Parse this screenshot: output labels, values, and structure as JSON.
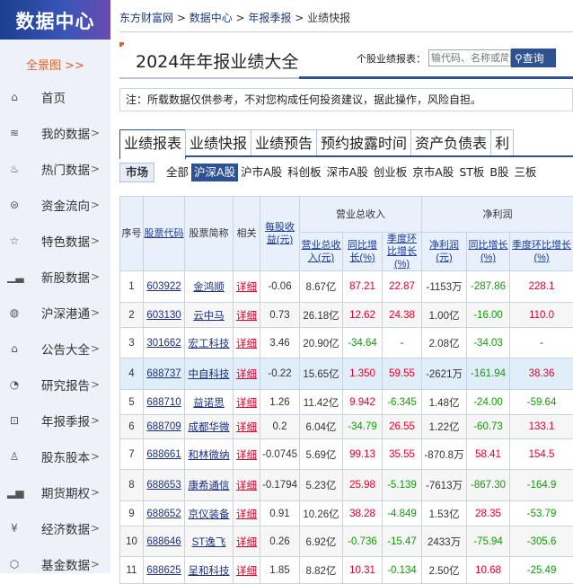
{
  "sidebar": {
    "logo": "数据中心",
    "overview": "全景图 >>",
    "items": [
      {
        "label": "首页",
        "icon": "home-icon",
        "glyph": "⌂",
        "chevron": ""
      },
      {
        "label": "我的数据",
        "icon": "layers-icon",
        "glyph": "≋",
        "chevron": ">"
      },
      {
        "label": "热门数据",
        "icon": "fire-icon",
        "glyph": "♨",
        "chevron": ">"
      },
      {
        "label": "资金流向",
        "icon": "flow-icon",
        "glyph": "⊜",
        "chevron": ">"
      },
      {
        "label": "特色数据",
        "icon": "star-badge-icon",
        "glyph": "☆",
        "chevron": ">"
      },
      {
        "label": "新股数据",
        "icon": "bar-icon",
        "glyph": "▁▃",
        "chevron": ">"
      },
      {
        "label": "沪深港通",
        "icon": "globe-icon",
        "glyph": "◍",
        "chevron": ">"
      },
      {
        "label": "公告大全",
        "icon": "notice-icon",
        "glyph": "⌂",
        "chevron": ">"
      },
      {
        "label": "研究报告",
        "icon": "pie-icon",
        "glyph": "◔",
        "chevron": ">"
      },
      {
        "label": "年报季报",
        "icon": "chart-icon",
        "glyph": "⊡",
        "chevron": ">"
      },
      {
        "label": "股东股本",
        "icon": "user-icon",
        "glyph": "♙",
        "chevron": ">"
      },
      {
        "label": "期货期权",
        "icon": "histogram-icon",
        "glyph": "▂▅",
        "chevron": ">"
      },
      {
        "label": "经济数据",
        "icon": "yen-icon",
        "glyph": "¥",
        "chevron": ">"
      },
      {
        "label": "基金数据",
        "icon": "fund-icon",
        "glyph": "⬡",
        "chevron": ">"
      }
    ]
  },
  "breadcrumb": [
    "东方财富网",
    "数据中心",
    "年报季报",
    "业绩快报"
  ],
  "title": "2024年年报业绩大全",
  "search": {
    "label": "个股业绩报表：",
    "placeholder": "输代码、名称或简拼",
    "button": "查询"
  },
  "note": "注：所载数据仅供参考，不对您构成任何投资建议，据此操作，风险自担。",
  "tabs": [
    "业绩报表",
    "业绩快报",
    "业绩预告",
    "预约披露时间",
    "资产负债表",
    "利"
  ],
  "market": {
    "label": "市场",
    "options": [
      "全部",
      "沪深A股",
      "沪市A股",
      "科创板",
      "深市A股",
      "创业板",
      "京市A股",
      "ST板",
      "B股",
      "三板"
    ],
    "selected": 1
  },
  "table": {
    "headers": {
      "seq": "序号",
      "code": "股票代码",
      "name": "股票简称",
      "rel": "相关",
      "eps": "每股收益(元)",
      "rev_group": "营业总收入",
      "rev": "营业总收入(元)",
      "rev_yoy": "同比增长(%)",
      "rev_qoq": "季度环比增长(%)",
      "np_group": "净利润",
      "np": "净利润(元)",
      "np_yoy": "同比增长(%)",
      "np_qoq": "季度环比增长(%)"
    },
    "rows": [
      [
        "1",
        "603922",
        "金鸿顺",
        "详细",
        "-0.06",
        "8.67亿",
        "87.21",
        "22.87",
        "-1153万",
        "-287.86",
        "228.1"
      ],
      [
        "2",
        "603130",
        "云中马",
        "详细",
        "0.73",
        "26.18亿",
        "12.62",
        "24.38",
        "1.00亿",
        "-16.00",
        "110.0"
      ],
      [
        "3",
        "301662",
        "宏工科技",
        "详细",
        "3.46",
        "20.90亿",
        "-34.64",
        "-",
        "2.08亿",
        "-34.03",
        "-"
      ],
      [
        "4",
        "688737",
        "中自科技",
        "详细",
        "-0.22",
        "15.65亿",
        "1.350",
        "59.55",
        "-2621万",
        "-161.94",
        "38.36"
      ],
      [
        "5",
        "688710",
        "益诺思",
        "详细",
        "1.26",
        "11.42亿",
        "9.942",
        "-6.345",
        "1.48亿",
        "-24.00",
        "-59.64"
      ],
      [
        "6",
        "688709",
        "成都华微",
        "详细",
        "0.2",
        "6.04亿",
        "-34.79",
        "26.55",
        "1.22亿",
        "-60.73",
        "133.1"
      ],
      [
        "7",
        "688661",
        "和林微纳",
        "详细",
        "-0.0745",
        "5.69亿",
        "99.13",
        "35.55",
        "-870.8万",
        "58.41",
        "154.5"
      ],
      [
        "8",
        "688653",
        "康希通信",
        "详细",
        "-0.1794",
        "5.23亿",
        "25.98",
        "-5.139",
        "-7613万",
        "-867.30",
        "-164.9"
      ],
      [
        "9",
        "688652",
        "京仪装备",
        "详细",
        "0.91",
        "10.26亿",
        "38.28",
        "-4.849",
        "1.53亿",
        "28.35",
        "-53.79"
      ],
      [
        "10",
        "688646",
        "ST逸飞",
        "详细",
        "0.26",
        "6.92亿",
        "-0.736",
        "-15.47",
        "2433万",
        "-75.94",
        "-305.6"
      ],
      [
        "11",
        "688625",
        "呈和科技",
        "详细",
        "1.85",
        "8.82亿",
        "10.31",
        "-0.134",
        "2.50亿",
        "10.68",
        "-25.49"
      ]
    ]
  }
}
